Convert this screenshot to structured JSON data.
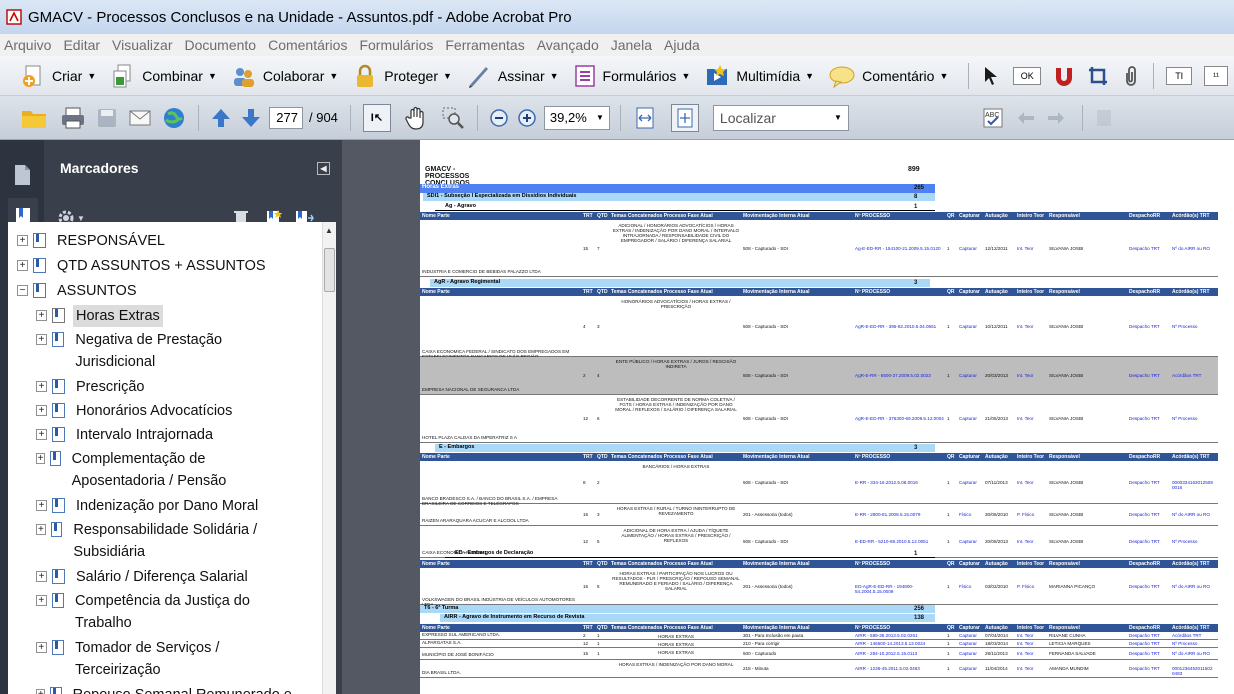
{
  "window": {
    "title": "GMACV - Processos Conclusos e na Unidade - Assuntos.pdf - Adobe Acrobat Pro"
  },
  "menu": [
    "Arquivo",
    "Editar",
    "Visualizar",
    "Documento",
    "Comentários",
    "Formulários",
    "Ferramentas",
    "Avançado",
    "Janela",
    "Ajuda"
  ],
  "toolbar1": {
    "criar": "Criar",
    "combinar": "Combinar",
    "colaborar": "Colaborar",
    "proteger": "Proteger",
    "assinar": "Assinar",
    "formularios": "Formulários",
    "multimidia": "Multimídia",
    "comentario": "Comentário"
  },
  "toolbar2": {
    "page": "277",
    "total": "/ 904",
    "zoom": "39,2%",
    "find_placeholder": "Localizar"
  },
  "bookmarks": {
    "title": "Marcadores",
    "items": [
      {
        "label": "RESPONSÁVEL"
      },
      {
        "label": "QTD ASSUNTOS + ASSUNTOS"
      },
      {
        "label": "ASSUNTOS"
      },
      {
        "label": "Horas Extras"
      },
      {
        "label": "Negativa de Prestação Jurisdicional"
      },
      {
        "label": "Prescrição"
      },
      {
        "label": "Honorários Advocatícios"
      },
      {
        "label": "Intervalo Intrajornada"
      },
      {
        "label": "Complementação de Aposentadoria / Pensão"
      },
      {
        "label": "Indenização por Dano Moral"
      },
      {
        "label": "Responsabilidade Solidária / Subsidiária"
      },
      {
        "label": "Salário / Diferença Salarial"
      },
      {
        "label": "Competência da Justiça do Trabalho"
      },
      {
        "label": "Tomador de Serviços / Terceirização"
      },
      {
        "label": "Repouso Semanal Remunerado e Feriado"
      }
    ]
  },
  "doc": {
    "title": "GMACV - PROCESSOS CONCLUSOS E NO GABINETE",
    "title_count": "899",
    "groups": {
      "horas": "Horas Extras",
      "horas_count": "265",
      "sdi": "SDI1 - Subseção I Especializada em Dissídios Individuais",
      "sdi_count": "8",
      "ag": "Ag - Agravo",
      "ag_count": "1",
      "agr": "AgR - Agravo Regimental",
      "agr_count": "3",
      "e": "E - Embargos",
      "e_count": "3",
      "ed": "ED - Embargos de Declaração",
      "ed_count": "1",
      "t6": "T6 - 6ª Turma",
      "t6_count": "256",
      "airr": "AIRR - Agravo de Instrumento em Recurso de Revista",
      "airr_count": "138"
    },
    "headers": [
      "Nome Parte",
      "TRT",
      "QTD",
      "Temas Concatenados Processo Fase Atual",
      "Movimentação Interna Atual",
      "Nº PROCESSO",
      "QR",
      "Capturar",
      "Autuação",
      "Inteiro Teor",
      "Responsável",
      "DespachoRR",
      "Acórdão(s) TRT"
    ],
    "rows": [
      {
        "parte": "INDUSTRIA E COMERCIO DE BEBIDAS PALAZZO LTDA",
        "trt": "15",
        "qtd": "7",
        "temas": "ADICIONAL / HONORÁRIOS ADVOCATÍCIOS / HORAS EXTRAS / INDENIZAÇÃO POR DANO MORAL / INTERVALO INTRAJORNADA / RESPONSABILIDADE CIVIL DO EMPREGADOR / SALÁRIO / DIFERENÇA SALARIAL",
        "mov": "508 - Capturado - SDI",
        "proc": "Ag-E-ED-RR - 154100-21.2009.5.15.0120",
        "qr": "1",
        "cap": "Capturar",
        "aut": "12/12/2011",
        "teor": "Int. Teor",
        "resp": "SILVANIA JOSBI",
        "desp": "Despacho TRT",
        "acord": "Nº do AIRR ou RO"
      },
      {
        "parte": "CAIXA ECONOMICA FEDERAL / SINDICATO DOS EMPREGADOS EM ESTABELECIMENTOS BANCARIOS DE IJUÍ E REGIÃO",
        "trt": "4",
        "qtd": "3",
        "temas": "HONORÁRIOS ADVOCATÍCIOS / HORAS EXTRAS / PRESCRIÇÃO",
        "mov": "508 - Capturado - SDI",
        "proc": "AgR-E-ED-RR - 395-82.2010.5.04.0661",
        "qr": "1",
        "cap": "Capturar",
        "aut": "10/12/2011",
        "teor": "Int. Teor",
        "resp": "SILVANIA JOSBI",
        "desp": "Despacho TRT",
        "acord": "Nº Processo"
      },
      {
        "parte": "EMPRESA NACIONAL DE SEGURANCA LTDA",
        "trt": "2",
        "qtd": "4",
        "temas": "ENTE PÚBLICO / HORAS EXTRAS / JUROS / RESCISÃO INDIRETA",
        "mov": "508 - Capturado - SDI",
        "proc": "AgR-E-RR - 6500-37.2009.5.02.0023",
        "qr": "1",
        "cap": "Capturar",
        "aut": "20/03/2013",
        "teor": "Int. Teor",
        "resp": "SILVANIA JOSBI",
        "desp": "Despacho TRT",
        "acord": "Acórdãos TRT"
      },
      {
        "parte": "HOTEL PLAZA CALDAS DA IMPERATRIZ S A",
        "trt": "12",
        "qtd": "6",
        "temas": "ESTABILIDADE DECORRENTE DE NORMA COLETIVA / FGTS / HORAS EXTRAS / INDENIZAÇÃO POR DANO MORAL / REFLEXOS / SALÁRIO / DIFERENÇA SALARIAL",
        "mov": "508 - Capturado - SDI",
        "proc": "AgR-E-ED-RR - 376300-69.2009.5.12.0004",
        "qr": "1",
        "cap": "Capturar",
        "aut": "21/05/2013",
        "teor": "Int. Teor",
        "resp": "SILVANIA JOSBI",
        "desp": "Despacho TRT",
        "acord": "Nº Processo"
      },
      {
        "parte": "BANCO BRADESCO S.A. / BANCO DO BRASIL S.A. / EMPRESA BRASILEIRA DE CORREIOS E TELÉGRAFOS",
        "trt": "8",
        "qtd": "2",
        "temas": "BANCÁRIOS / HORAS EXTRAS",
        "mov": "508 - Capturado - SDI",
        "proc": "E-RR - 334-16.2012.5.08.0016",
        "qr": "1",
        "cap": "Capturar",
        "aut": "07/11/2013",
        "teor": "Int. Teor",
        "resp": "SILVANIA JOSBI",
        "desp": "Despacho TRT",
        "acord": "0000334162012508 0016"
      },
      {
        "parte": "RAIZEN ARARAQUARA ACUCAR E ALCOOL LTDA",
        "trt": "15",
        "qtd": "3",
        "temas": "HORAS EXTRAS / RURAL / TURNO ININTERRUPTO DE REVEZAMENTO",
        "mov": "201 - Assessoria (todos)",
        "proc": "E-RR - 2800-81.2008.5.15.0079",
        "qr": "1",
        "cap": "Físico",
        "aut": "30/06/2010",
        "teor": "P. Físico",
        "resp": "SILVANIA JOSBI",
        "desp": "Despacho TRT",
        "acord": "Nº do AIRR ou RO"
      },
      {
        "parte": "CAIXA ECONOMICA FEDERAL",
        "trt": "12",
        "qtd": "5",
        "temas": "ADICIONAL DE HORA EXTRA / AJUDA / TÍQUETE ALIMENTAÇÃO / HORAS EXTRAS / PRESCRIÇÃO / REFLEXOS",
        "mov": "508 - Capturado - SDI",
        "proc": "E-ED-RR - 5210-69.2010.5.12.0051",
        "qr": "1",
        "cap": "Capturar",
        "aut": "20/08/2013",
        "teor": "Int. Teor",
        "resp": "SILVANIA JOSBI",
        "desp": "Despacho TRT",
        "acord": "Nº Processo"
      },
      {
        "parte": "VOLKSWAGEN DO BRASIL INDÚSTRIA DE VEÍCULOS AUTOMOTORES LTDA.",
        "trt": "15",
        "qtd": "5",
        "temas": "HORAS EXTRAS / PARTICIPAÇÃO NOS LUCROS OU RESULTADOS - PLR / PRESCRIÇÃO / REPOUSO SEMANAL REMUNERADO E FERIADO / SALÁRIO / DIFERENÇA SALARIAL",
        "mov": "201 - Assessoria (todos)",
        "proc": "ED-AgR-E-ED-RR - 194800-54.2004.5.15.0009",
        "qr": "1",
        "cap": "Físico",
        "aut": "03/02/2010",
        "teor": "P. Físico",
        "resp": "MARIANNA PICANÇO",
        "desp": "Despacho TRT",
        "acord": "Nº do AIRR ou RO"
      },
      {
        "parte": "EXPRESSO SUL AMERICANO LTDA.",
        "trt": "2",
        "qtd": "1",
        "temas": "HORAS EXTRAS",
        "mov": "301 - Para Inclusão em pauta",
        "proc": "AIRR - 589-35.2013.5.02.0261",
        "qr": "1",
        "cap": "Capturar",
        "aut": "07/04/2014",
        "teor": "Int. Teor",
        "resp": "RILVANE CUNHA",
        "desp": "Despacho TRT",
        "acord": "Acórdãos TRT"
      },
      {
        "parte": "ALPARGATAS S.A.",
        "trt": "12",
        "qtd": "1",
        "temas": "HORAS EXTRAS",
        "mov": "210 - Para corrigir",
        "proc": "AIRR - 146500-14.2013.5.13.0024",
        "qr": "1",
        "cap": "Capturar",
        "aut": "18/03/2014",
        "teor": "Int. Teor",
        "resp": "LETICIA MARQUES",
        "desp": "Despacho TRT",
        "acord": "Nº Processo"
      },
      {
        "parte": "MUNICÍPIO DE JOSÉ BONIFÁCIO",
        "trt": "15",
        "qtd": "1",
        "temas": "HORAS EXTRAS",
        "mov": "500 - Capturado",
        "proc": "AIRR - 284-10.2012.5.15.0113",
        "qr": "1",
        "cap": "Capturar",
        "aut": "28/11/2013",
        "teor": "Int. Teor",
        "resp": "FERNANDA SALVADE",
        "desp": "Despacho TRT",
        "acord": "Nº do AIRR ou RO"
      },
      {
        "parte": "DIA BRASIL LTDA.",
        "trt": "",
        "qtd": "",
        "temas": "HORAS EXTRAS / INDENIZAÇÃO POR DANO MORAL",
        "mov": "218 - Minuta",
        "proc": "AIRR - 1236-45.2011.5.02.0483",
        "qr": "1",
        "cap": "Capturar",
        "aut": "11/04/2014",
        "teor": "Int. Teor",
        "resp": "AMANDA MUNDIM",
        "desp": "Despacho TRT",
        "acord": "0001236452011502 0483"
      }
    ]
  }
}
